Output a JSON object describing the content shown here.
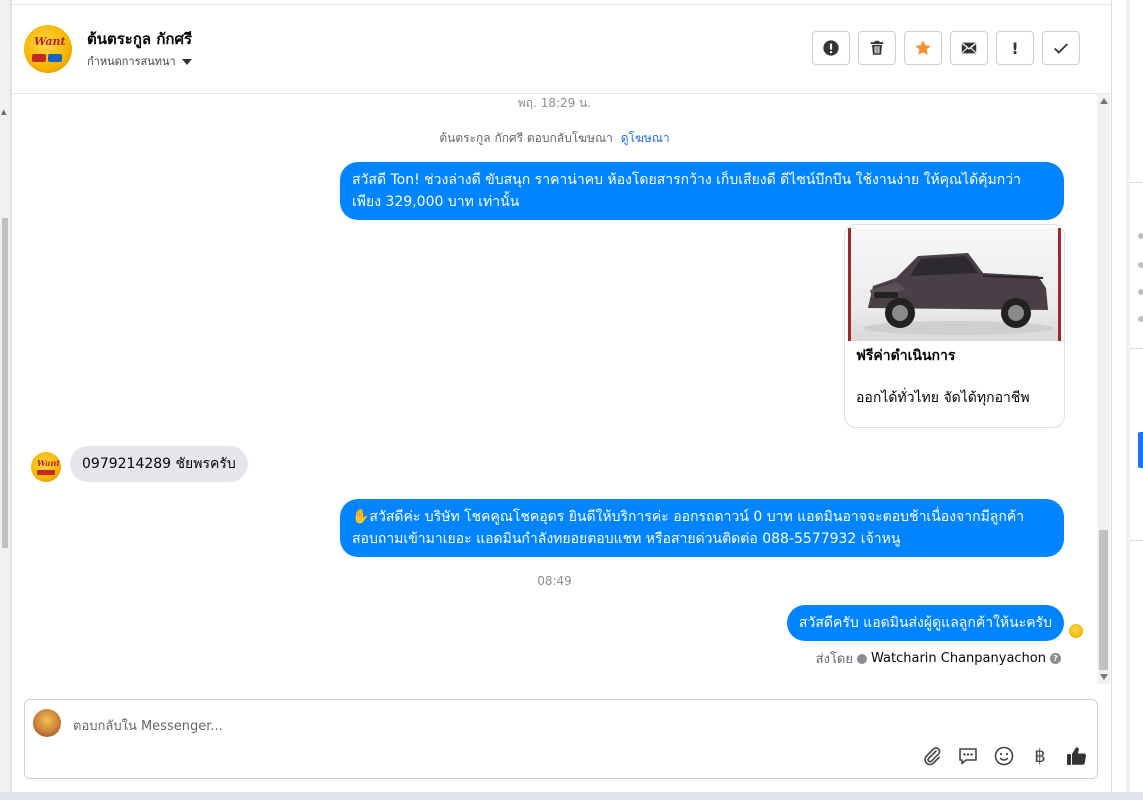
{
  "header": {
    "contact_name": "ต้นตระกูล กักศรี",
    "assign_label": "กำหนดการสนทนา",
    "avatar_logo_text": "Want",
    "toolbar": [
      {
        "name": "mark-spam-button",
        "icon": "exclamation-circle-icon"
      },
      {
        "name": "delete-button",
        "icon": "trash-icon"
      },
      {
        "name": "star-button",
        "icon": "star-icon"
      },
      {
        "name": "mark-unread-button",
        "icon": "envelope-icon"
      },
      {
        "name": "follow-up-button",
        "icon": "exclamation-icon",
        "label": "!"
      },
      {
        "name": "mark-done-button",
        "icon": "check-icon"
      }
    ]
  },
  "conversation": {
    "timestamp_1": "พฤ. 18:29 น.",
    "ad_reply_text": "ต้นตระกูล กักศรี ตอบกลับโฆษณา",
    "ad_reply_link": "ดูโฆษณา",
    "message_1": "สวัสดี Ton! ช่วงล่างดี ขับสนุก ราคาน่าคบ ห้องโดยสารกว้าง เก็บเสียงดี ดีไซน์บึกบึน ใช้งานง่าย ให้คุณได้คุ้มกว่า เพียง 329,000 บาท เท่านั้น",
    "card": {
      "title": "ฟรีค่าดำเนินการ",
      "description": "ออกได้ทั่วไทย จัดได้ทุกอาชีพ"
    },
    "incoming_message": "0979214289 ชัยพรครับ",
    "message_2": "✋สวัสดีค่ะ บริษัท โชคคูณโชคอุดร ยินดีให้บริการค่ะ ออกรถดาวน์ 0 บาท แอดมินอาจจะตอบช้าเนื่องจากมีลูกค้าสอบถามเข้ามาเยอะ แอดมินกำลังทยอยตอบแชท หรือสายด่วนติดต่อ 088-5577932 เจ้าหนู",
    "timestamp_2": "08:49",
    "message_3": "สวัสดีครับ แอดมินส่งผู้ดูแลลูกค้าให้นะครับ",
    "sent_by_label": "ส่งโดย",
    "sent_by_name": "Watcharin Chanpanyachon"
  },
  "composer": {
    "placeholder": "ตอบกลับใน Messenger...",
    "actions": [
      "paperclip-icon",
      "saved-replies-icon",
      "emoji-icon",
      "baht-icon",
      "thumbs-up-icon"
    ],
    "baht_symbol": "฿"
  },
  "colors": {
    "outgoing_bubble": "#0084ff",
    "incoming_bubble": "#e4e6eb",
    "star": "#f7923b",
    "link": "#216fdb"
  }
}
